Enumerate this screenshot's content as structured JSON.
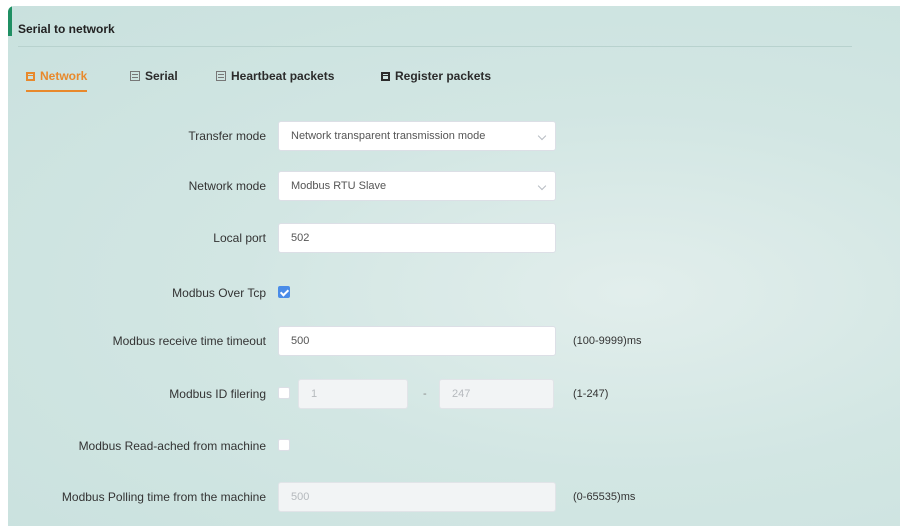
{
  "panel": {
    "title": "Serial to network"
  },
  "tabs": [
    {
      "label": "Network",
      "icon": "grid-icon",
      "active": true
    },
    {
      "label": "Serial",
      "icon": "grid-icon",
      "active": false
    },
    {
      "label": "Heartbeat packets",
      "icon": "grid-icon",
      "active": false
    },
    {
      "label": "Register packets",
      "icon": "grid-icon",
      "active": false
    }
  ],
  "form": {
    "transfer_mode": {
      "label": "Transfer mode",
      "value": "Network transparent transmission mode"
    },
    "network_mode": {
      "label": "Network mode",
      "value": "Modbus RTU Slave"
    },
    "local_port": {
      "label": "Local port",
      "value": "502"
    },
    "modbus_over_tcp": {
      "label": "Modbus Over Tcp",
      "checked": true
    },
    "receive_timeout": {
      "label": "Modbus receive time timeout",
      "value": "500",
      "hint": "(100-9999)ms"
    },
    "id_filtering": {
      "label": "Modbus ID filering",
      "checked": false,
      "from": "1",
      "separator": "-",
      "to": "247",
      "hint": "(1-247)"
    },
    "read_cached": {
      "label": "Modbus Read-ached from machine",
      "checked": false
    },
    "polling_time": {
      "label": "Modbus Polling time from the machine",
      "value": "500",
      "hint": "(0-65535)ms"
    }
  },
  "colors": {
    "accent": "#e8892c",
    "checkbox_checked": "#4a8ce8",
    "edge": "#1f8f63"
  }
}
